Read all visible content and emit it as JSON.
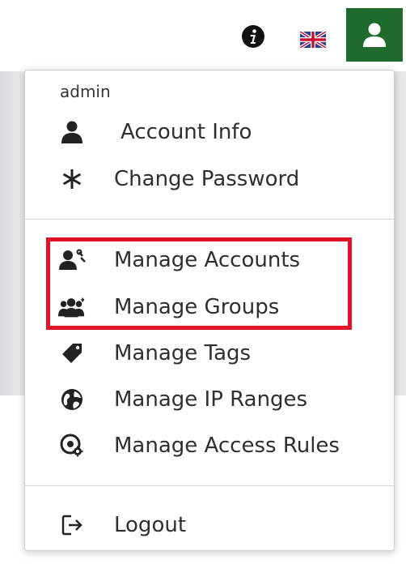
{
  "header": {
    "info_icon": "info-circle-icon",
    "flag_icon": "uk-flag-icon",
    "user_icon": "user-icon",
    "user_button_color": "#1e6b2d"
  },
  "menu": {
    "username": "admin",
    "items": [
      {
        "label": "Account Info",
        "icon": "user-icon"
      },
      {
        "label": "Change Password",
        "icon": "asterisk-icon"
      },
      {
        "label": "Manage Accounts",
        "icon": "user-wrench-icon"
      },
      {
        "label": "Manage Groups",
        "icon": "users-icon"
      },
      {
        "label": "Manage Tags",
        "icon": "tag-icon"
      },
      {
        "label": "Manage IP Ranges",
        "icon": "globe-icon"
      },
      {
        "label": "Manage Access Rules",
        "icon": "shield-gear-icon"
      },
      {
        "label": "Logout",
        "icon": "logout-icon"
      }
    ]
  },
  "annotation": {
    "highlight_color": "#e3122a"
  }
}
